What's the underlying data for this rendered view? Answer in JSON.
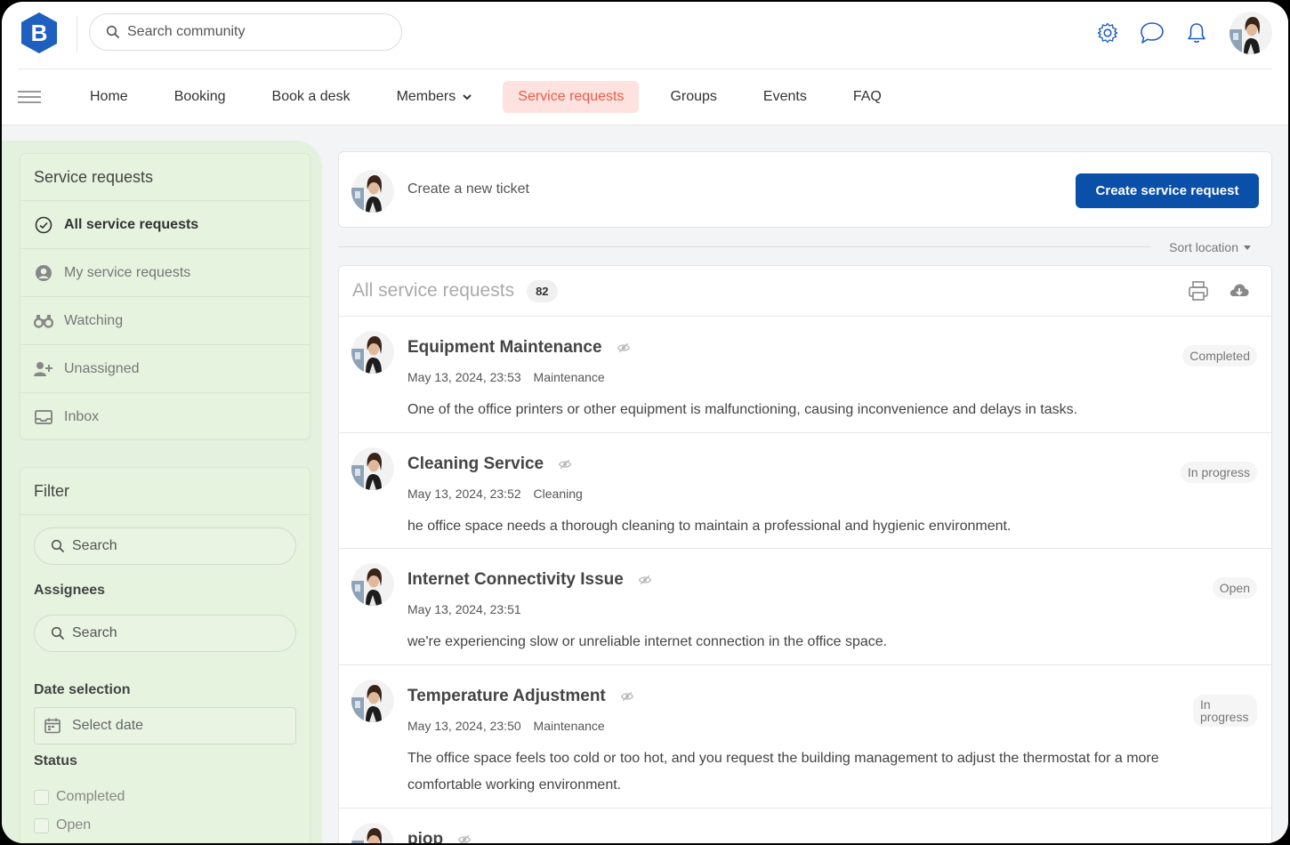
{
  "header": {
    "logo_letter": "B",
    "search_placeholder": "Search community",
    "icons": [
      "gear-icon",
      "chat-icon",
      "bell-icon"
    ]
  },
  "nav": {
    "items": [
      {
        "label": "Home"
      },
      {
        "label": "Booking"
      },
      {
        "label": "Book a desk"
      },
      {
        "label": "Members"
      },
      {
        "label": "Service requests"
      },
      {
        "label": "Groups"
      },
      {
        "label": "Events"
      },
      {
        "label": "FAQ"
      }
    ],
    "active": "Service requests"
  },
  "sidebar": {
    "title": "Service requests",
    "items": [
      {
        "label": "All service requests",
        "icon": "check-circle-icon"
      },
      {
        "label": "My service requests",
        "icon": "user-circle-icon"
      },
      {
        "label": "Watching",
        "icon": "binoculars-icon"
      },
      {
        "label": "Unassigned",
        "icon": "user-plus-icon"
      },
      {
        "label": "Inbox",
        "icon": "inbox-icon"
      }
    ],
    "filter": {
      "title": "Filter",
      "search_placeholder": "Search",
      "assignees_label": "Assignees",
      "assignees_placeholder": "Search",
      "date_label": "Date selection",
      "date_placeholder": "Select date",
      "status_label": "Status",
      "status_options": [
        "Completed",
        "Open"
      ]
    }
  },
  "ticket": {
    "prompt": "Create a new ticket",
    "button": "Create service request"
  },
  "sort": {
    "label": "Sort location"
  },
  "list": {
    "title": "All service requests",
    "count": "82",
    "requests": [
      {
        "title": "Equipment Maintenance",
        "date": "May 13, 2024, 23:53",
        "category": "Maintenance",
        "description": "One of the office printers or other equipment is malfunctioning, causing inconvenience and delays in tasks.",
        "status": "Completed"
      },
      {
        "title": "Cleaning Service",
        "date": "May 13, 2024, 23:52",
        "category": "Cleaning",
        "description": "he office space needs a thorough cleaning to maintain a professional and hygienic environment.",
        "status": "In progress"
      },
      {
        "title": "Internet Connectivity Issue",
        "date": "May 13, 2024, 23:51",
        "category": "",
        "description": "we're experiencing slow or unreliable internet connection in the office space.",
        "status": "Open"
      },
      {
        "title": "Temperature Adjustment",
        "date": "May 13, 2024, 23:50",
        "category": "Maintenance",
        "description": "The office space feels too cold or too hot, and you request the building management to adjust the thermostat for a more comfortable working environment.",
        "status": "In progress"
      },
      {
        "title": "piop",
        "date": "",
        "category": "",
        "description": "",
        "status": ""
      }
    ]
  },
  "colors": {
    "accent": "#0a4fa8",
    "nav_active_bg": "#fde2df",
    "nav_active_text": "#ef5a4a",
    "sidebar_bg": "#e4f1de"
  }
}
